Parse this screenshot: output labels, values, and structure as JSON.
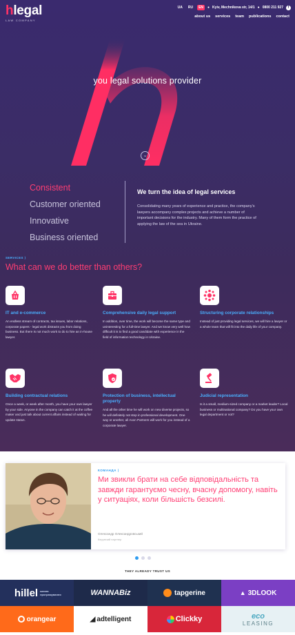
{
  "brand": {
    "logo_prefix": "h",
    "logo_rest": "legal",
    "tagline": "LAW COMPANY"
  },
  "topbar": {
    "languages": [
      {
        "label": "UA"
      },
      {
        "label": "RU"
      },
      {
        "label": "EN",
        "active": true
      }
    ],
    "address": "Kyiv, Mechnikova str, 14/1",
    "phone": "0800 211 927",
    "social_icon": "facebook-icon"
  },
  "nav": {
    "items": [
      "about us",
      "services",
      "team",
      "publications",
      "contact"
    ]
  },
  "hero": {
    "title": "you legal solutions provider"
  },
  "values": [
    "Consistent",
    "Customer oriented",
    "Innovative",
    "Business oriented"
  ],
  "about": {
    "title": "We turn the idea of legal services",
    "text": "Consolidating many years of experience and practice, the company's lawyers accompany complex projects and achieve a number of important decisions for the industry. Many of them form the practice of applying the law of the sea in Ukraine."
  },
  "services": {
    "label": "SERVICES",
    "title": "What can we do better than others?",
    "items": [
      {
        "icon": "basket-icon",
        "title": "IT and e-commerce",
        "text": "An endless stream of contracts, tax issues, labor relations, corporate papers - legal work distracts you from doing business. But there is not much work to do to hire an in-house lawyer."
      },
      {
        "icon": "briefcase-icon",
        "title": "Comprehensive daily legal support",
        "text": "In addition, over time, the work will become the same type and uninteresting for a full-time lawyer. And we know very well how difficult it is to find a good candidate with experience in the field of information technology in Ukraine."
      },
      {
        "icon": "network-icon",
        "title": "Structuring corporate relationships",
        "text": "Instead of just providing legal services, we will hire a lawyer or a whole team that will fit into the daily life of your company."
      },
      {
        "icon": "handshake-icon",
        "title": "Building contractual relations",
        "text": "Once a week, or week after month, you have your own lawyer by your side. Anyone in the company can catch it at the coffee maker and just talk about current affairs instead of waiting for update status."
      },
      {
        "icon": "shield-icon",
        "title": "Protection of business, intellectual property",
        "text": "And all the other time he will work on new diverse projects, so he will definitely not stop in professional development. One way or another, all Axon Partners will work for you instead of a corporate lawyer."
      },
      {
        "icon": "gavel-icon",
        "title": "Judicial representation",
        "text": "Is it a small, medium-sized company or a market leader? Local business or multinational company? Do you have your own legal department or not?"
      }
    ]
  },
  "testimonial": {
    "label": "КОМАНДА",
    "quote": "Ми звикли брати на себе відповідальність та завжди гарантуємо чесну, вчасну допомогу, навіть у ситуаціях, коли більшість безсилі.",
    "author": "Олександр Олександровський",
    "role": "Керуючий партнер",
    "slides": 3,
    "active_slide": 0
  },
  "trust": {
    "title": "THEY ALREADY TRUST US",
    "logos": [
      {
        "name": "hillel",
        "sub": "школа програмування",
        "bg": "#23305c",
        "color": "#ffffff"
      },
      {
        "name": "WANNABiz",
        "bg": "#1e2a4a",
        "color": "#ffffff"
      },
      {
        "name": "tapgerine",
        "bg": "#1f3150",
        "color": "#ffffff"
      },
      {
        "name": "3DLOOK",
        "bg": "#7b3fc4",
        "color": "#ffffff"
      },
      {
        "name": "orangear",
        "bg": "#ff6a1a",
        "color": "#ffffff"
      },
      {
        "name": "adtelligent",
        "bg": "#ffffff",
        "color": "#222222"
      },
      {
        "name": "Clickky",
        "bg": "#d8263a",
        "color": "#ffffff"
      },
      {
        "name": "eco",
        "sub": "LEASING",
        "bg": "#e7f1f4",
        "color": "#4a7f8c"
      }
    ]
  },
  "colors": {
    "accent": "#ff3366",
    "blue": "#4ab0ff",
    "dark_bg": "#3b2d66"
  }
}
